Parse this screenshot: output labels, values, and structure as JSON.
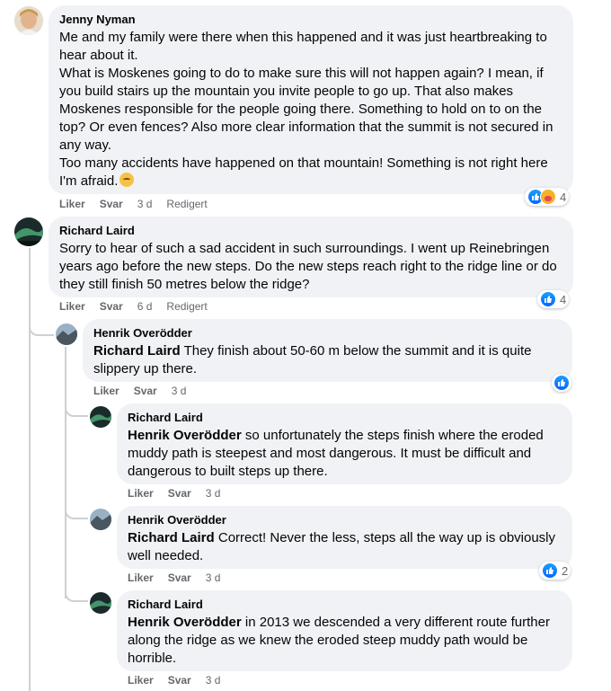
{
  "comments": [
    {
      "author": "Jenny Nyman",
      "text": "Me and my family were there when this happened and it was just heartbreaking to hear about it.\nWhat is Moskenes going to do to make sure this will not happen again? I mean, if you build stairs up the mountain you invite people to go up. That also makes Moskenes responsible for the people going there. Something to hold on to on the top? Or even fences? Also more clear information that the summit is not secured in any way.\nToo many accidents have happened on that mountain! Something is not right here I'm afraid.",
      "like": "Liker",
      "reply": "Svar",
      "time": "3 d",
      "edited": "Redigert",
      "reactions": "4"
    },
    {
      "author": "Richard Laird",
      "text": "Sorry to hear of such a sad accident in such surroundings. I went up Reinebringen years ago before the new steps. Do the new steps reach right to the ridge line or do they still finish 50 metres below the ridge?",
      "like": "Liker",
      "reply": "Svar",
      "time": "6 d",
      "edited": "Redigert",
      "reactions": "4"
    },
    {
      "author": "Henrik Overödder",
      "mention": "Richard Laird",
      "text": " They finish about 50-60 m below the summit and it is quite slippery up there.",
      "like": "Liker",
      "reply": "Svar",
      "time": "3 d"
    },
    {
      "author": "Richard Laird",
      "mention": "Henrik Overödder",
      "text": " so unfortunately the steps finish where the eroded muddy path is steepest and most dangerous. It must be difficult and dangerous to built steps up there.",
      "like": "Liker",
      "reply": "Svar",
      "time": "3 d"
    },
    {
      "author": "Henrik Overödder",
      "mention": "Richard Laird",
      "text": " Correct! Never the less, steps all the way up is obviously well needed.",
      "like": "Liker",
      "reply": "Svar",
      "time": "3 d",
      "reactions": "2"
    },
    {
      "author": "Richard Laird",
      "mention": "Henrik Overödder",
      "text": " in 2013 we descended a very different route further along the ridge as we knew the eroded steep muddy path would be horrible.",
      "like": "Liker",
      "reply": "Svar",
      "time": "3 d"
    }
  ],
  "icons": {
    "like_reaction": "like-icon",
    "care_reaction": "care-icon",
    "emoji": "pensive-face-emoji"
  },
  "colors": {
    "bubble": "#f0f2f5",
    "like_blue": "#0866ff",
    "meta_gray": "#65676b"
  }
}
